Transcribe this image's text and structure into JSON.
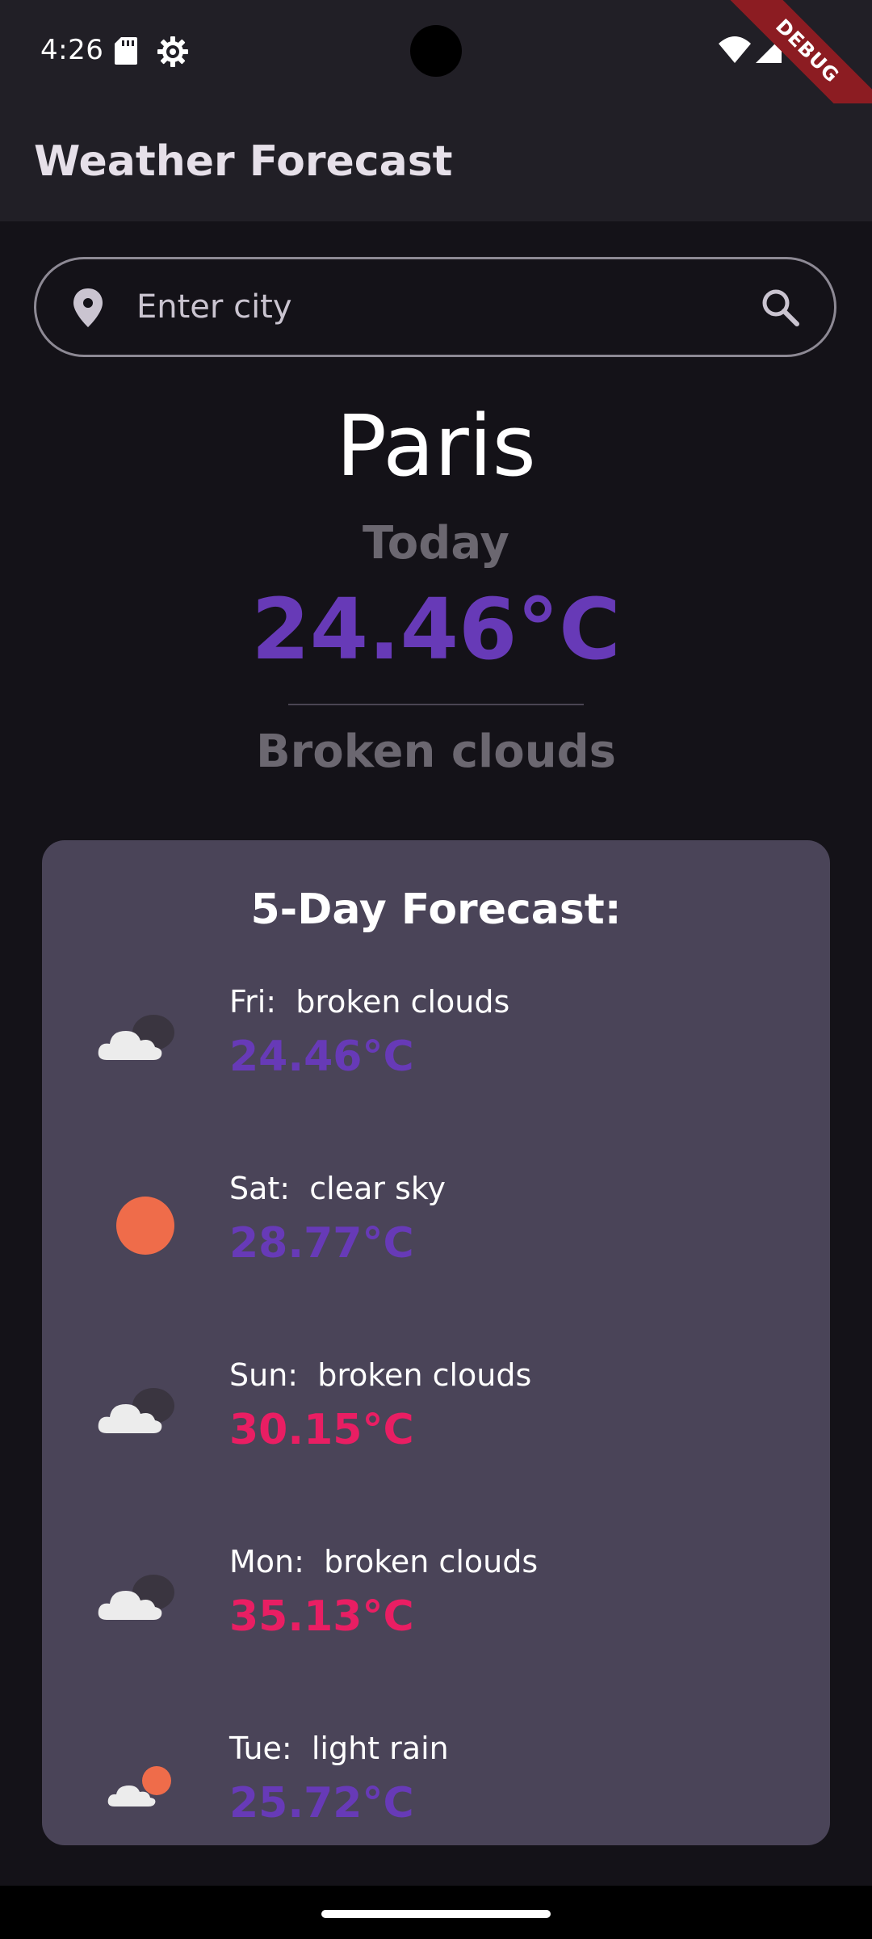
{
  "status_bar": {
    "time": "4:26",
    "debug_label": "DEBUG"
  },
  "app_bar": {
    "title": "Weather Forecast"
  },
  "search": {
    "placeholder": "Enter city",
    "value": ""
  },
  "current": {
    "city": "Paris",
    "day_label": "Today",
    "temperature": "24.46°C",
    "condition": "Broken clouds",
    "temp_color": "#673ab7"
  },
  "forecast": {
    "title": "5-Day Forecast:",
    "items": [
      {
        "label": "Fri:  broken clouds",
        "temp": "24.46°C",
        "icon": "broken-clouds-icon",
        "temp_color": "#673ab7"
      },
      {
        "label": "Sat:  clear sky",
        "temp": "28.77°C",
        "icon": "clear-sky-icon",
        "temp_color": "#673ab7"
      },
      {
        "label": "Sun:  broken clouds",
        "temp": "30.15°C",
        "icon": "broken-clouds-icon",
        "temp_color": "#e91e63"
      },
      {
        "label": "Mon:  broken clouds",
        "temp": "35.13°C",
        "icon": "broken-clouds-icon",
        "temp_color": "#e91e63"
      },
      {
        "label": "Tue:  light rain",
        "temp": "25.72°C",
        "icon": "light-rain-icon",
        "temp_color": "#673ab7"
      }
    ]
  },
  "colors": {
    "background": "#141218",
    "app_bar": "#211f26",
    "card": "#4a4458",
    "accent_cool": "#673ab7",
    "accent_hot": "#e91e63"
  }
}
